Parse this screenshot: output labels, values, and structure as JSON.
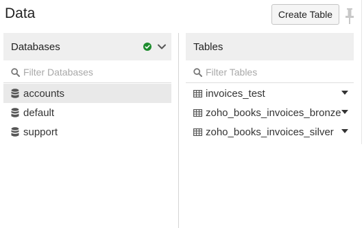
{
  "header": {
    "title": "Data",
    "create_table_label": "Create Table"
  },
  "databases_panel": {
    "title": "Databases",
    "filter_placeholder": "Filter Databases",
    "items": [
      {
        "label": "accounts",
        "selected": true
      },
      {
        "label": "default",
        "selected": false
      },
      {
        "label": "support",
        "selected": false
      }
    ]
  },
  "tables_panel": {
    "title": "Tables",
    "filter_placeholder": "Filter Tables",
    "items": [
      {
        "label": "invoices_test"
      },
      {
        "label": "zoho_books_invoices_bronze"
      },
      {
        "label": "zoho_books_invoices_silver"
      }
    ]
  },
  "colors": {
    "status_ok": "#1e8c2e",
    "panel_header_bg": "#efefef",
    "selected_row_bg": "#e9e9e9"
  },
  "icons": {
    "pin": "pin-icon",
    "status": "check-circle-icon",
    "collapse": "chevron-down-icon",
    "search": "search-icon",
    "database": "database-icon",
    "table": "table-icon",
    "row_menu": "caret-down-icon"
  }
}
